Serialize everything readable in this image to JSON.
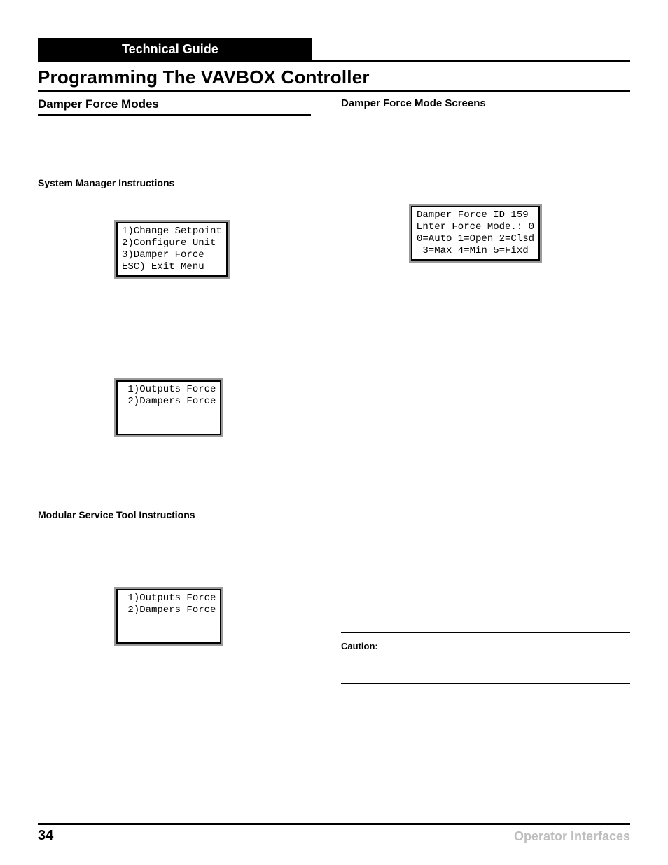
{
  "header": {
    "guide": "Technical Guide"
  },
  "title": "Programming The VAVBOX Controller",
  "left": {
    "heading": "Damper Force Modes",
    "sysmgr_label": "System Manager Instructions",
    "lcd1": {
      "l1": "1)Change Setpoint",
      "l2": "2)Configure Unit",
      "l3": "3)Damper Force",
      "l4": "ESC) Exit Menu"
    },
    "lcd2": {
      "l1": " 1)Outputs Force",
      "l2": " 2)Dampers Force",
      "l3": " ",
      "l4": " "
    },
    "modsvc_label": "Modular Service Tool Instructions",
    "lcd3": {
      "l1": " 1)Outputs Force",
      "l2": " 2)Dampers Force",
      "l3": " ",
      "l4": " "
    }
  },
  "right": {
    "heading": "Damper Force Mode Screens",
    "lcd": {
      "l1": "Damper Force ID 159",
      "l2": "Enter Force Mode.: 0",
      "l3": "0=Auto 1=Open 2=Clsd",
      "l4": " 3=Max 4=Min 5=Fixd"
    },
    "caution": "Caution:"
  },
  "footer": {
    "page": "34",
    "label": "Operator Interfaces"
  }
}
